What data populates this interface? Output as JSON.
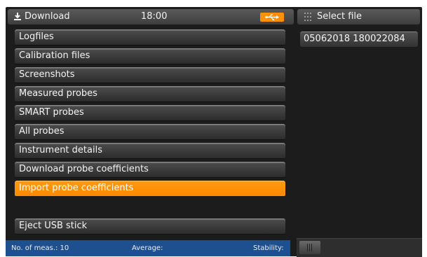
{
  "header": {
    "title": "Download",
    "time": "18:00",
    "usb_icon": "usb-icon",
    "download_icon": "download-icon"
  },
  "side_panel": {
    "title": "Select file",
    "files": [
      "05062018 180022084"
    ]
  },
  "menu": {
    "items": [
      "Logfiles",
      "Calibration files",
      "Screenshots",
      "Measured probes",
      "SMART probes",
      "All probes",
      "Instrument details",
      "Download probe coefficients",
      "Import probe coefficients"
    ],
    "active_index": 8,
    "eject_label": "Eject USB stick"
  },
  "status_bar": {
    "measurements": "No. of meas.: 10",
    "average": "Average:",
    "stability": "Stability:"
  },
  "colors": {
    "accent": "#ff9100",
    "status_bar": "#1e4f8e",
    "background": "#1c1c1c"
  }
}
